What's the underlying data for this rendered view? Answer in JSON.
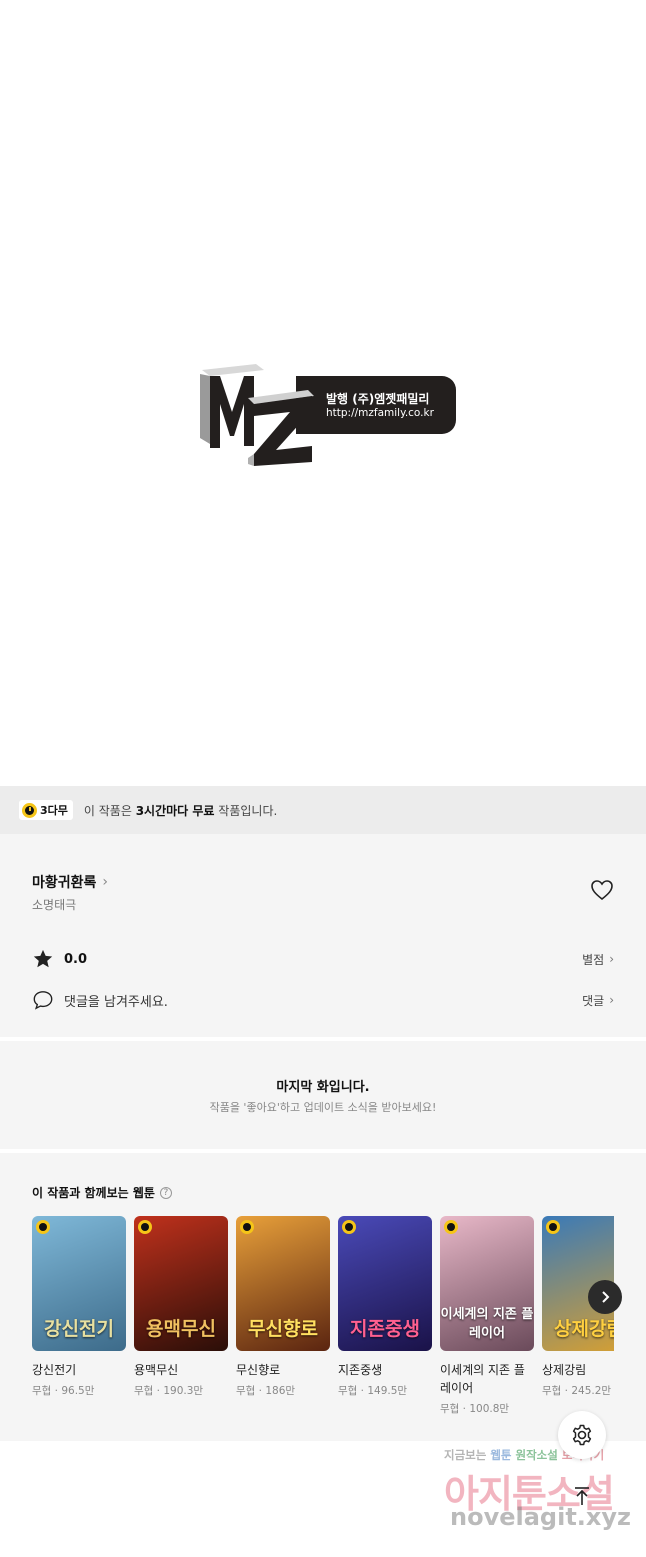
{
  "publisher_logo": {
    "publisher": "발행 (주)엠젯패밀리",
    "url": "http://mzfamily.co.kr"
  },
  "notice": {
    "badge": "3다무",
    "text_prefix": "이 작품은 ",
    "text_bold": "3시간마다 무료",
    "text_suffix": " 작품입니다."
  },
  "work": {
    "title": "마황귀환록",
    "author": "소명태극",
    "rating": "0.0",
    "rating_link": "별점",
    "comment_prompt": "댓글을 남겨주세요.",
    "comment_link": "댓글"
  },
  "last_episode": {
    "title": "마지막 화입니다.",
    "subtitle": "작품을 '좋아요'하고 업데이트 소식을 받아보세요!"
  },
  "recommendations": {
    "heading": "이 작품과 함께보는 웹툰",
    "items": [
      {
        "title": "강신전기",
        "meta": "무협 · 96.5만",
        "cover_text": "강신전기",
        "colors": [
          "#7fb8d8",
          "#3d6b8a"
        ],
        "text_color": "#e8e0a0"
      },
      {
        "title": "용맥무신",
        "meta": "무협 · 190.3만",
        "cover_text": "용맥무신",
        "colors": [
          "#c0311c",
          "#2a0e08"
        ],
        "text_color": "#f0c060"
      },
      {
        "title": "무신향로",
        "meta": "무협 · 186만",
        "cover_text": "무신향로",
        "colors": [
          "#e8a03a",
          "#5a2410"
        ],
        "text_color": "#ffe060"
      },
      {
        "title": "지존중생",
        "meta": "무협 · 149.5만",
        "cover_text": "지존중생",
        "colors": [
          "#4a4ab8",
          "#1a1248"
        ],
        "text_color": "#ff6090"
      },
      {
        "title": "이세계의 지존 플레이어",
        "meta": "무협 · 100.8만",
        "cover_text": "이세계의 지존 플레이어",
        "colors": [
          "#e8b8c8",
          "#6a4a5a"
        ],
        "text_color": "#ffffff"
      },
      {
        "title": "상제강림",
        "meta": "무협 · 245.2만",
        "cover_text": "상제강림",
        "colors": [
          "#3a7ab8",
          "#d8a030"
        ],
        "text_color": "#ffd040"
      }
    ]
  },
  "watermark": {
    "line1_a": "지금보는 ",
    "line1_b": "웹툰",
    "line1_c": " 원작소설",
    "line1_d": " 보러가기",
    "line2": "아지툰소설",
    "line3": "novelagit.xyz"
  },
  "colors": {
    "accent_yellow": "#f5c518",
    "panel_bg": "#f5f5f5",
    "notice_bg": "#ececec"
  },
  "icons": {
    "notice": "clock-icon",
    "like": "heart-icon",
    "rating": "star-icon",
    "comment": "speech-bubble-icon",
    "next": "chevron-right-icon",
    "settings": "gear-icon",
    "top": "arrow-up-icon"
  }
}
